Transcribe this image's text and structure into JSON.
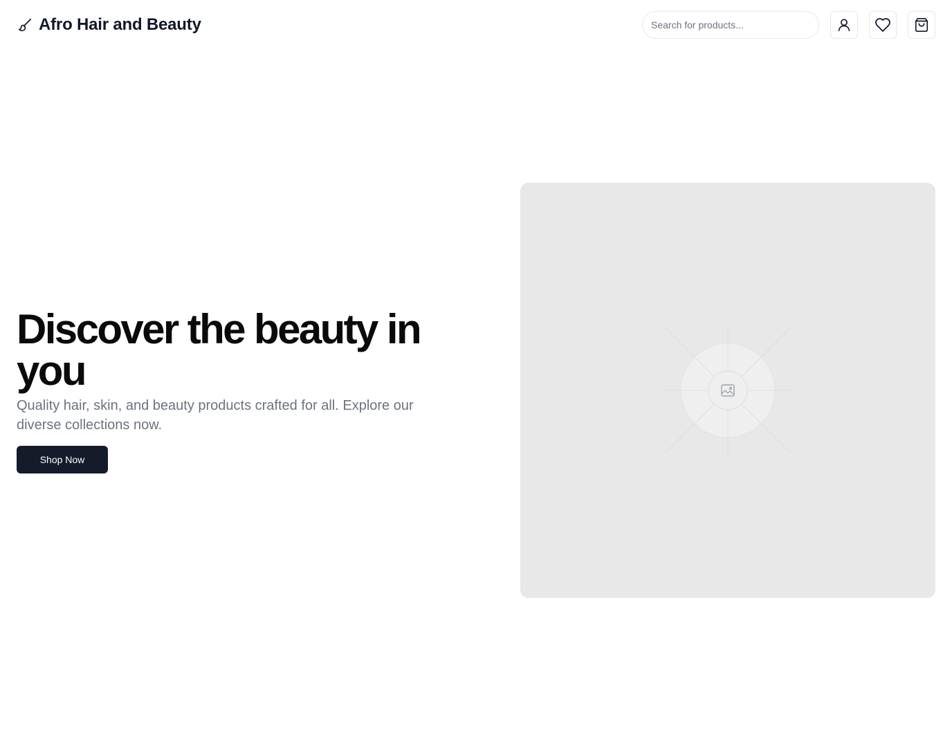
{
  "header": {
    "brand_icon": "paintbrush-icon",
    "brand_name": "Afro Hair and Beauty",
    "search": {
      "placeholder": "Search for products...",
      "value": ""
    },
    "actions": [
      {
        "name": "account",
        "icon": "user-icon"
      },
      {
        "name": "wishlist",
        "icon": "heart-icon"
      },
      {
        "name": "cart",
        "icon": "shopping-bag-icon"
      }
    ]
  },
  "hero": {
    "title": "Discover the beauty in you",
    "subtitle": "Quality hair, skin, and beauty products crafted for all. Explore our diverse collections now.",
    "cta_label": "Shop Now",
    "image_icon": "image-placeholder-icon"
  },
  "colors": {
    "primary": "#151b2b",
    "text": "#111827",
    "muted": "#6b7280",
    "border": "#e5e7eb",
    "placeholder_bg": "#e8e8e8"
  }
}
